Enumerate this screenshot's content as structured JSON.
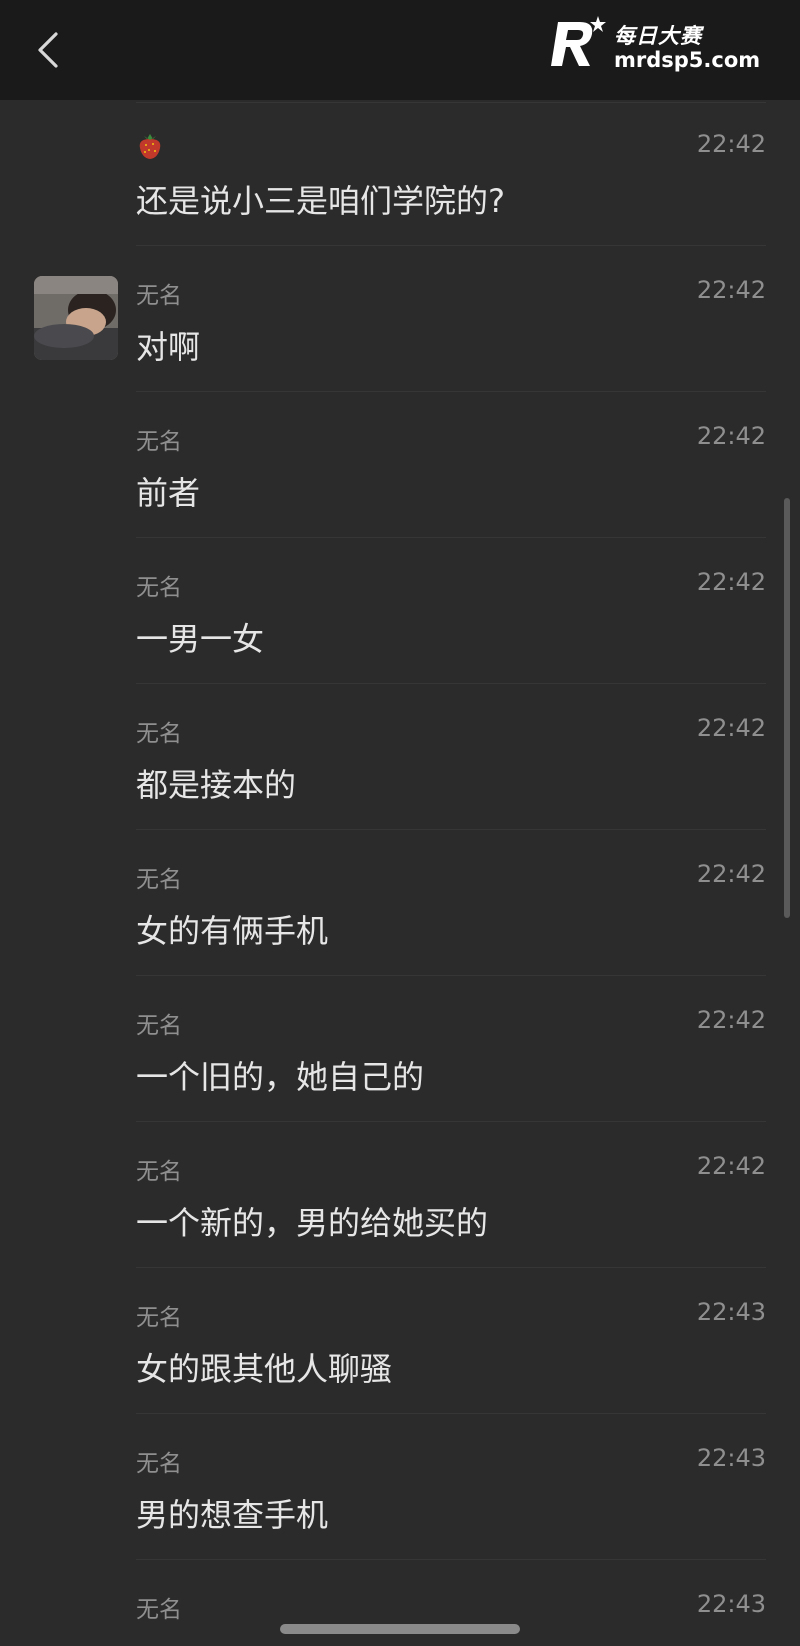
{
  "header": {
    "back_icon": "chevron-left-icon",
    "watermark_title": "每日大赛",
    "watermark_domain": "mrdsp5.com",
    "watermark_logo_icon": "r-star-logo-icon"
  },
  "messages": [
    {
      "sender": "",
      "sender_icon": "strawberry-icon",
      "time": "22:42",
      "text": "还是说小三是咱们学院的?",
      "has_avatar": false
    },
    {
      "sender": "无名",
      "time": "22:42",
      "text": "对啊",
      "has_avatar": true
    },
    {
      "sender": "无名",
      "time": "22:42",
      "text": "前者",
      "has_avatar": false
    },
    {
      "sender": "无名",
      "time": "22:42",
      "text": "一男一女",
      "has_avatar": false
    },
    {
      "sender": "无名",
      "time": "22:42",
      "text": "都是接本的",
      "has_avatar": false
    },
    {
      "sender": "无名",
      "time": "22:42",
      "text": "女的有俩手机",
      "has_avatar": false
    },
    {
      "sender": "无名",
      "time": "22:42",
      "text": "一个旧的，她自己的",
      "has_avatar": false
    },
    {
      "sender": "无名",
      "time": "22:42",
      "text": "一个新的，男的给她买的",
      "has_avatar": false
    },
    {
      "sender": "无名",
      "time": "22:43",
      "text": "女的跟其他人聊骚",
      "has_avatar": false
    },
    {
      "sender": "无名",
      "time": "22:43",
      "text": "男的想查手机",
      "has_avatar": false
    },
    {
      "sender": "无名",
      "time": "22:43",
      "text": "",
      "has_avatar": false
    }
  ],
  "colors": {
    "background": "#2b2b2b",
    "topbar": "#1a1a1a",
    "primary_text": "#e6e6e6",
    "secondary_text": "#8f8f8f"
  }
}
